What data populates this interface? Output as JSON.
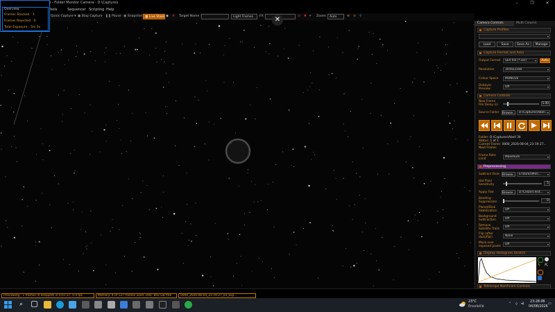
{
  "window": {
    "title": "4 bit) - Folder Monitor Camera - D:\\Captures",
    "controls": [
      "–",
      "❐",
      "✕"
    ]
  },
  "menu": [
    "Tools",
    "Sequencer",
    "Scripting",
    "Help"
  ],
  "toolbar": {
    "quick_capture": "Quick Capture ▾",
    "stop_capture": "Stop Capture",
    "pause": "Pause",
    "snapshot": "Snapshot",
    "live_stack": "Live Stack",
    "target_name_label": "Target Name :",
    "target_name_value": "",
    "frame_type": "Light Frames",
    "fx_label": "FX",
    "fx_value": "",
    "zoom_label": "Zoom:",
    "zoom_value": "Auto"
  },
  "overview": {
    "title": "Overview",
    "frames_stacked_label": "Frames Stacked :",
    "frames_stacked": "1",
    "frames_rejected_label": "Frames Rejected :",
    "frames_rejected": "0",
    "total_exposure_label": "Total Exposure :",
    "total_exposure": "5m 0s"
  },
  "close_overlay": "✕",
  "panel": {
    "tabs": [
      "Camera Controls",
      "Multi Column"
    ],
    "capture_profiles": {
      "title": "Capture Profiles",
      "buttons": [
        "Load",
        "Save",
        "Save As",
        "Manage"
      ]
    },
    "capture_format": {
      "title": "Capture Format and Area",
      "output_format_label": "Output Format",
      "output_format": "SER file (*.ser)",
      "auto_label": "Auto",
      "resolution_label": "Resolution",
      "resolution": "3056x2180",
      "colour_space_label": "Colour Space",
      "colour_space": "MONO16",
      "debayer_label": "Debayer Preview",
      "debayer": "Off"
    },
    "camera_controls": {
      "title": "Camera Controls",
      "new_frame_label": "New Frame File Delay (s)",
      "new_frame_value": "5.00",
      "source_folder_label": "Source Folder",
      "browse": "Browse...",
      "source_folder": "D:\\Captures\\Abell..."
    },
    "folder_info": {
      "folder_label": "Folder:",
      "folder": "D:\\Captures\\Abell 39",
      "status_label": "Status:",
      "status": "1 of 1",
      "current_frame_label": "Current Frame:",
      "current_frame": "0000_2026-08-04_23-19-27...",
      "next_frame_label": "Next Frame:",
      "next_frame": "",
      "frame_rate_label": "Frame Rate Limit",
      "frame_rate": "Maximum"
    },
    "preprocessing": {
      "title": "Preprocessing",
      "subtract_dark_label": "Subtract Dark",
      "browse": "Browse...",
      "subtract_dark": "E:\\darks\\Mini...",
      "hot_pixel_label": "Hot Pixel Sensitivity",
      "hot_pixel_value": "5",
      "apply_flat_label": "Apply Flat",
      "apply_flat": "D:\\Cleans\\Test...",
      "banding_label": "Banding Suppression",
      "banding_value": "0",
      "amp_glow_label": "Planet/Disk Stabilization",
      "amp_glow": "Off",
      "background_label": "Background Subtraction",
      "background": "Off",
      "remove_sat_label": "Remove Satellite Trails",
      "remove_sat": "Off",
      "flip_label": "Flip (after dark/flat)",
      "flip": "None",
      "mask_label": "Mask over exposed pixels",
      "mask": "Off"
    },
    "histogram": {
      "title": "Display Histogram Stretch"
    },
    "telescope": {
      "title": "Telescope Northcam Controls"
    }
  },
  "statusbar": {
    "previewing": "Previewing : 1 frames (0 dropped) in 0:01:37, 0.0 fps",
    "memory": "Memory: 4 of 127 frames used, Disk: 842 GB free",
    "file": "0000_2026-08-04_23-19-27_03_Exp..."
  },
  "taskbar": {
    "weather_temp": "23°C",
    "weather_desc": "Ensoleillé",
    "time": "23:28:06",
    "date": "04/08/2026"
  },
  "colors": {
    "accent": "#c86a00",
    "label_orange": "#e09030",
    "preprocessing": "#7a2a8a",
    "overview_border": "#1e6fd9"
  }
}
